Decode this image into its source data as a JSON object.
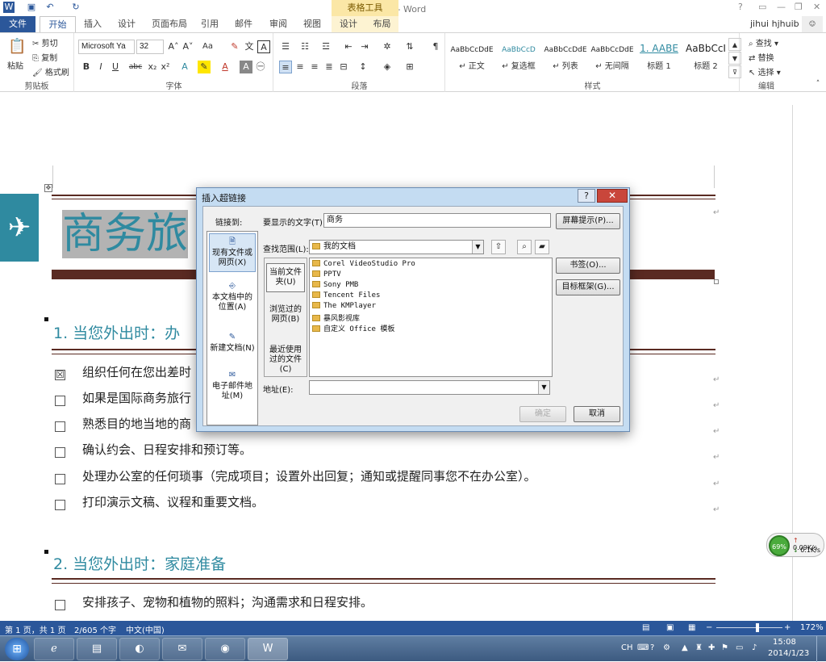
{
  "window": {
    "title": "文档1 - Word",
    "context_tab_title": "表格工具",
    "help": "?",
    "user": "jihui hjhuib"
  },
  "tabs": [
    "文件",
    "开始",
    "插入",
    "设计",
    "页面布局",
    "引用",
    "邮件",
    "审阅",
    "视图",
    "设计",
    "布局"
  ],
  "ribbon": {
    "clipboard": {
      "paste": "粘贴",
      "cut": "剪切",
      "copy": "复制",
      "format_painter": "格式刷",
      "label": "剪贴板"
    },
    "font": {
      "name": "Microsoft Ya",
      "size": "32",
      "label": "字体",
      "case": "Aa",
      "bold": "B",
      "italic": "I",
      "underline": "U",
      "strike": "abc",
      "sub": "x₂",
      "sup": "x²"
    },
    "paragraph": {
      "label": "段落"
    },
    "styles": {
      "label": "样式",
      "items": [
        {
          "sample": "AaBbCcDdE",
          "name": "↵ 正文",
          "color": "#222222"
        },
        {
          "sample": "AaBbCcD",
          "name": "↵ 复选框",
          "color": "#2f8aa0"
        },
        {
          "sample": "AaBbCcDdE",
          "name": "↵ 列表",
          "color": "#222222"
        },
        {
          "sample": "AaBbCcDdE",
          "name": "↵ 无间隔",
          "color": "#222222"
        },
        {
          "sample": "1. AABE",
          "name": "标题 1",
          "color": "#2f8aa0"
        },
        {
          "sample": "AaBbCcI",
          "name": "标题 2",
          "color": "#222222"
        }
      ]
    },
    "editing": {
      "find": "查找",
      "replace": "替换",
      "select": "选择",
      "label": "编辑"
    }
  },
  "document": {
    "title_text": "商务旅",
    "section1": "1.  当您外出时：办",
    "items1": [
      {
        "text": "组织任何在您出差时",
        "checked": true
      },
      {
        "text": "如果是国际商务旅行",
        "checked": false
      },
      {
        "text": "熟悉目的地当地的商",
        "checked": false
      },
      {
        "text": "确认约会、日程安排和预订等。",
        "checked": false
      },
      {
        "text": "处理办公室的任何琐事（完成项目；设置外出回复；通知或提醒同事您不在办公室）。",
        "checked": false
      },
      {
        "text": "打印演示文稿、议程和重要文档。",
        "checked": false
      }
    ],
    "section2": "2.  当您外出时：家庭准备",
    "items2": [
      {
        "text": "安排孩子、宠物和植物的照料；沟通需求和日程安排。",
        "checked": false
      }
    ],
    "para_mark": "↵"
  },
  "dialog": {
    "title": "插入超链接",
    "help": "?",
    "close": "✕",
    "link_to": "链接到:",
    "display_text_label": "要显示的文字(T):",
    "display_text_value": "商务",
    "screen_tip": "屏幕提示(P)...",
    "look_in_label": "查找范围(L):",
    "look_in_value": "我的文档",
    "link_types": [
      {
        "label": "现有文件或网页(X)",
        "icon": "🗎",
        "selected": true
      },
      {
        "label": "本文档中的位置(A)",
        "icon": "⎆",
        "selected": false
      },
      {
        "label": "新建文档(N)",
        "icon": "✎",
        "selected": false
      },
      {
        "label": "电子邮件地址(M)",
        "icon": "✉",
        "selected": false
      }
    ],
    "sub_items": [
      {
        "label": "当前文件夹(U)",
        "selected": true
      },
      {
        "label": "浏览过的网页(B)",
        "selected": false
      },
      {
        "label": "最近使用过的文件(C)",
        "selected": false
      }
    ],
    "files": [
      "Corel VideoStudio Pro",
      "PPTV",
      "Sony PMB",
      "Tencent Files",
      "The KMPlayer",
      "暴风影视库",
      "自定义 Office 模板"
    ],
    "bookmark": "书签(O)...",
    "target_frame": "目标框架(G)...",
    "address_label": "地址(E):",
    "address_value": "",
    "ok": "确定",
    "cancel": "取消"
  },
  "statusbar": {
    "page": "第 1 页，共 1 页",
    "words": "2/605 个字",
    "lang": "中文(中国)",
    "zoom": "172%",
    "zoom_fraction": 0.62
  },
  "network": {
    "percent": "69%",
    "up": "0.09K/s",
    "down": "0.1K/s"
  },
  "taskbar": {
    "lang": "CH",
    "time": "15:08",
    "date": "2014/1/23"
  }
}
